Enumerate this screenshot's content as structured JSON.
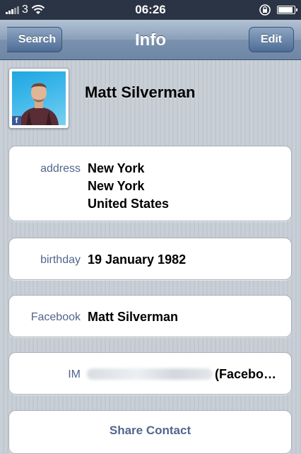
{
  "status_bar": {
    "carrier": "3",
    "time": "06:26",
    "icons": [
      "signal-icon",
      "wifi-icon",
      "rotation-lock-icon",
      "battery-icon"
    ],
    "battery_level": 0.9
  },
  "nav": {
    "back_label": "Search",
    "title": "Info",
    "edit_label": "Edit"
  },
  "contact": {
    "name": "Matt Silverman",
    "avatar_badge": "f"
  },
  "fields": {
    "address": {
      "label": "address",
      "lines": [
        "New York",
        "New York",
        "United States"
      ]
    },
    "birthday": {
      "label": "birthday",
      "value": "19 January 1982"
    },
    "facebook": {
      "label": "Facebook",
      "value": "Matt Silverman"
    },
    "im": {
      "label": "IM",
      "value_suffix": "(Facebo…"
    }
  },
  "actions": {
    "share_label": "Share Contact"
  },
  "colors": {
    "navbar": "#7a91ae",
    "label_blue": "#51668d",
    "facebook_blue": "#3b5998"
  }
}
